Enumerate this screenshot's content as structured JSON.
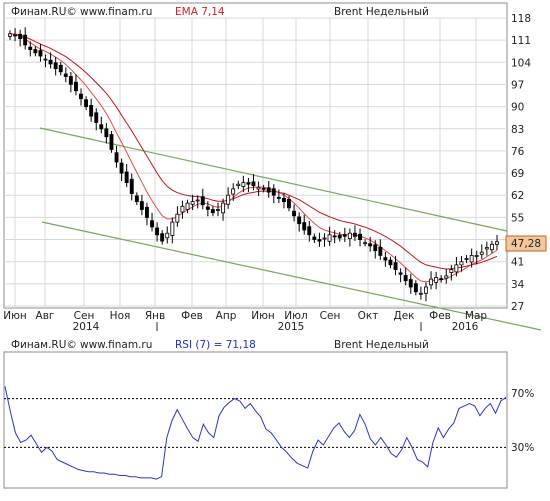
{
  "colors": {
    "frame": "#8c8c8c",
    "grid": "#d9d9d9",
    "bull": "#ffffff",
    "bear": "#000000",
    "wick": "#000000",
    "ema_fast": "#e8474f",
    "ema_slow": "#c2151c",
    "channel": "#74a860",
    "price_label_bg": "#f2c79e",
    "price_label_border": "#c0661e",
    "rsi_line": "#2a35c9",
    "rsi_ref": "#000000",
    "ema_label": "#d21f26",
    "rsi_label": "#1b2fc0"
  },
  "chart_data": [
    {
      "type": "candlestick",
      "header": {
        "source": "Финам.RU©",
        "site": "www.finam.ru",
        "indicator": "EMA 7,14",
        "title": "Brent Недельный"
      },
      "y_ticks": [
        "118",
        "111",
        "104",
        "97",
        "90",
        "83",
        "76",
        "69",
        "62",
        "55",
        "48",
        "41",
        "34",
        "27"
      ],
      "ylim": [
        27,
        118
      ],
      "x_month_labels": [
        "Июн",
        "Авг",
        "Сен",
        "Ноя",
        "Янв",
        "Фев",
        "Апр",
        "Июн",
        "Июл",
        "Сен",
        "Окт",
        "Дек",
        "Фев",
        "Мар"
      ],
      "x_year_labels": [
        "2014",
        "2015",
        "2016"
      ],
      "last_price_label": "47,28",
      "closes": [
        113,
        112.5,
        111.5,
        109.5,
        108,
        107,
        106,
        105,
        103.5,
        102,
        101,
        99.5,
        97,
        95,
        92.5,
        90,
        87,
        85,
        83,
        80.5,
        76.5,
        72.5,
        69,
        66,
        62.5,
        60,
        57.5,
        55,
        52,
        49.5,
        47.5,
        50,
        53.5,
        56,
        58.5,
        59.5,
        60,
        60.5,
        59,
        57.5,
        56.5,
        57.5,
        59.5,
        62,
        64,
        65.5,
        66,
        65.5,
        65,
        64.5,
        64,
        63,
        62,
        61,
        60,
        58,
        55.5,
        53,
        51,
        49.5,
        48,
        47.5,
        48.5,
        49.5,
        49,
        48.5,
        49,
        50,
        49,
        48,
        47,
        46,
        44.5,
        43,
        41.5,
        40,
        38.5,
        37,
        35,
        33,
        31.5,
        31,
        33,
        35.5,
        36,
        35.5,
        36.5,
        38.5,
        40,
        41,
        42,
        43,
        43,
        44,
        45.5,
        46.5,
        47.3
      ],
      "ema_fast": [
        113,
        112.8,
        112.3,
        111.3,
        110.2,
        109.1,
        108.2,
        107.4,
        106.6,
        105.6,
        104.6,
        103.3,
        101.8,
        100.1,
        98.4,
        96.6,
        94.5,
        92.5,
        90.3,
        87.8,
        84.9,
        81.7,
        78.7,
        75.6,
        72.3,
        69.2,
        66.1,
        63.0,
        60.3,
        57.8,
        55.5,
        54.5,
        54.6,
        55.3,
        56.4,
        57.4,
        58.3,
        59.2,
        59.5,
        59.3,
        58.6,
        58.2,
        58.6,
        59.7,
        61.2,
        62.6,
        63.6,
        64.3,
        64.5,
        64.6,
        64.5,
        64.2,
        63.6,
        62.9,
        62.1,
        60.9,
        59.5,
        57.9,
        56.2,
        54.6,
        53.1,
        51.8,
        51.0,
        50.5,
        50.1,
        49.7,
        49.5,
        49.6,
        49.5,
        49.1,
        48.5,
        47.8,
        46.8,
        45.7,
        44.5,
        43.3,
        41.9,
        40.6,
        39.1,
        37.6,
        36.1,
        34.9,
        34.6,
        34.9,
        35.2,
        35.3,
        35.6,
        36.4,
        37.3,
        38.2,
        39.1,
        40.1,
        40.9,
        41.6,
        42.6,
        43.6,
        44.7
      ],
      "ema_slow": [
        113,
        112.9,
        112.6,
        112.0,
        111.3,
        110.5,
        109.8,
        109.1,
        108.4,
        107.5,
        106.7,
        105.8,
        104.6,
        103.4,
        102.1,
        100.7,
        99.2,
        97.6,
        95.9,
        94.2,
        92.1,
        89.8,
        87.3,
        84.8,
        82.3,
        79.7,
        77.0,
        74.3,
        71.7,
        69.0,
        66.6,
        64.8,
        63.6,
        62.8,
        62.3,
        61.9,
        61.7,
        61.6,
        61.3,
        60.9,
        60.4,
        60.1,
        60.1,
        60.4,
        60.9,
        61.5,
        62.2,
        62.6,
        62.9,
        63.2,
        63.3,
        63.3,
        63.2,
        62.9,
        62.6,
        62.0,
        61.3,
        60.6,
        59.6,
        58.6,
        57.6,
        56.6,
        55.9,
        55.2,
        54.6,
        54.0,
        53.6,
        53.3,
        52.9,
        52.4,
        51.9,
        51.3,
        50.6,
        49.8,
        49.0,
        48.0,
        47.0,
        45.9,
        44.6,
        43.3,
        42.0,
        40.8,
        40.0,
        39.6,
        39.3,
        38.9,
        38.7,
        38.8,
        39.0,
        39.3,
        39.6,
        40.0,
        40.4,
        40.8,
        41.4,
        42.0,
        42.7
      ],
      "channel": {
        "upper": [
          {
            "i": 0,
            "y": 83.5
          },
          {
            "i": 96,
            "y": 50
          }
        ],
        "lower": [
          {
            "i": 0,
            "y": 54.5
          },
          {
            "i": 96,
            "y": 23
          }
        ]
      }
    },
    {
      "type": "line",
      "header": {
        "source": "Финам.RU©",
        "site": "www.finam.ru",
        "indicator": "RSI (7) = 71,18",
        "title": "Brent Недельный"
      },
      "ylim": [
        0,
        100
      ],
      "reference_lines": [
        70,
        30
      ],
      "ref_labels": [
        "70%",
        "30%"
      ],
      "rsi": [
        80,
        60,
        42,
        34,
        36,
        40,
        33,
        26,
        30,
        27,
        20,
        18,
        16,
        14,
        12,
        11,
        10,
        10,
        9,
        9,
        8,
        8,
        7,
        7,
        6,
        6,
        5,
        5,
        5,
        4,
        6,
        38,
        52,
        61,
        53,
        45,
        38,
        35,
        49,
        42,
        38,
        56,
        63,
        67,
        70,
        68,
        62,
        66,
        60,
        55,
        45,
        42,
        36,
        30,
        26,
        21,
        17,
        15,
        13,
        27,
        36,
        32,
        39,
        46,
        50,
        43,
        38,
        44,
        57,
        49,
        37,
        32,
        38,
        32,
        25,
        22,
        28,
        38,
        30,
        20,
        18,
        14,
        34,
        46,
        38,
        45,
        50,
        62,
        64,
        66,
        64,
        56,
        62,
        66,
        58,
        68,
        71
      ]
    }
  ]
}
